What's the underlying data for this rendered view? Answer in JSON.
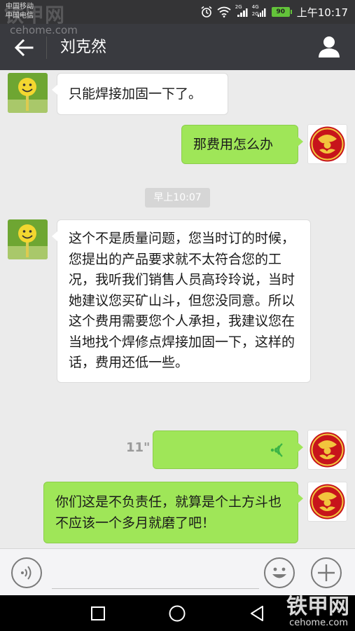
{
  "status_bar": {
    "carrier_1": "中国移动",
    "carrier_2": "中国电信",
    "network_1": "2G",
    "network_2": "4G",
    "network_3": "2G",
    "battery": "90",
    "time": "上午10:17"
  },
  "watermark": {
    "top_brand": "铁甲网",
    "top_url": "cehome.com",
    "bottom_brand": "铁甲网",
    "bottom_url": "cehome.com"
  },
  "header": {
    "title": "刘克然",
    "back_icon": "arrow-left-icon",
    "profile_icon": "person-icon"
  },
  "messages": [
    {
      "side": "left",
      "text": "只能焊接加固一下了。"
    },
    {
      "side": "right",
      "text": "那费用怎么办"
    },
    {
      "type": "timestamp",
      "text": "早上10:07"
    },
    {
      "side": "left",
      "text": "这个不是质量问题，您当时订的时候，您提出的产品要求就不太符合您的工况，我听我们销售人员高玲玲说，当时她建议您买矿山斗，但您没同意。所以这个费用需要您个人承担，我建议您在当地找个焊修点焊接加固一下，这样的话，费用还低一些。"
    },
    {
      "side": "right",
      "type": "voice",
      "duration": "11\""
    },
    {
      "side": "right",
      "text": "你们这是不负责任，就算是个土方斗也不应该一个多月就磨了吧！"
    }
  ],
  "input_bar": {
    "voice_icon": "voice-input-icon",
    "text_value": "",
    "emoji_icon": "smiley-icon",
    "plus_icon": "plus-icon"
  },
  "colors": {
    "header_bg": "#393a3f",
    "chat_bg": "#ebebeb",
    "sent_bubble": "#9fe658",
    "received_bubble": "#ffffff",
    "voice_wave": "#3bb346",
    "battery": "#63c33a"
  }
}
